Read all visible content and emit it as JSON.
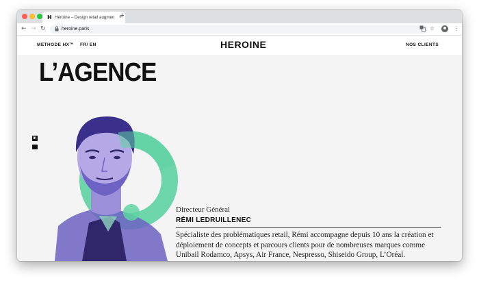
{
  "browser": {
    "tab": {
      "favicon": "H",
      "title": "Héroïne – Design retail augmen",
      "close": "×"
    },
    "new_tab": "+",
    "nav": {
      "back": "←",
      "forward": "→",
      "reload": "↻"
    },
    "url": "heroine.paris",
    "icons": [
      "translate-icon",
      "star-icon",
      "profile-icon",
      "menu-icon"
    ]
  },
  "site": {
    "nav_left": [
      "METHODE HX™",
      "FR/ EN"
    ],
    "logo": "HEROINE",
    "nav_right": "NOS CLIENTS"
  },
  "page": {
    "heading": "L’AGENCE",
    "social": [
      "linkedin-icon",
      "mail-icon"
    ],
    "person": {
      "role": "Directeur Général",
      "name": "RÉMI LEDRUILLENEC",
      "bio": "Spécialiste des problématiques retail, Rémi accompagne depuis 10 ans la création et déploiement de concepts et parcours clients pour de nombreuses marques comme Unibail Rodamco, Apsys, Air France, Nespresso, Shiseido Group, L’Oréal."
    }
  },
  "colors": {
    "accent_green": "#5fd3a3",
    "illustration_purple": "#5b4fb0",
    "background": "#f4f4f4"
  }
}
